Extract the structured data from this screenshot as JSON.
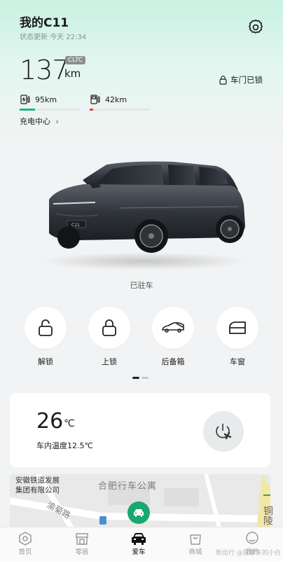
{
  "header": {
    "title": "我的C11",
    "status": "状态更新 今天 22:34"
  },
  "range": {
    "value": "137",
    "unit": "km",
    "standard": "CLTC"
  },
  "door_status": "车门已锁",
  "electric": {
    "label": "95km",
    "fill_fraction": 0.26,
    "color": "#1db676"
  },
  "fuel": {
    "label": "42km",
    "fill_fraction": 0.06,
    "color": "#e04545"
  },
  "charging_center": "充电中心",
  "parked_status": "已驻车",
  "controls": [
    {
      "label": "解锁",
      "icon": "unlock-icon"
    },
    {
      "label": "上锁",
      "icon": "lock-icon"
    },
    {
      "label": "后备箱",
      "icon": "trunk-icon"
    },
    {
      "label": "车窗",
      "icon": "window-icon"
    }
  ],
  "climate": {
    "set_temp": "26",
    "unit": "℃",
    "indoor": "车内温度12.5℃"
  },
  "map": {
    "label_1": "安徽铁道发展",
    "label_2": "集团有限公司",
    "label_3": "合肥行车公寓",
    "label_4": "渝菊路",
    "label_5": "铜陵"
  },
  "tabs": [
    {
      "label": "首页",
      "icon": "home-icon"
    },
    {
      "label": "零居",
      "icon": "store-icon"
    },
    {
      "label": "爱车",
      "icon": "car-icon",
      "active": true
    },
    {
      "label": "商城",
      "icon": "shop-icon"
    },
    {
      "label": "我的",
      "icon": "profile-icon"
    }
  ],
  "watermark": "新出行 @就爱车的小白"
}
